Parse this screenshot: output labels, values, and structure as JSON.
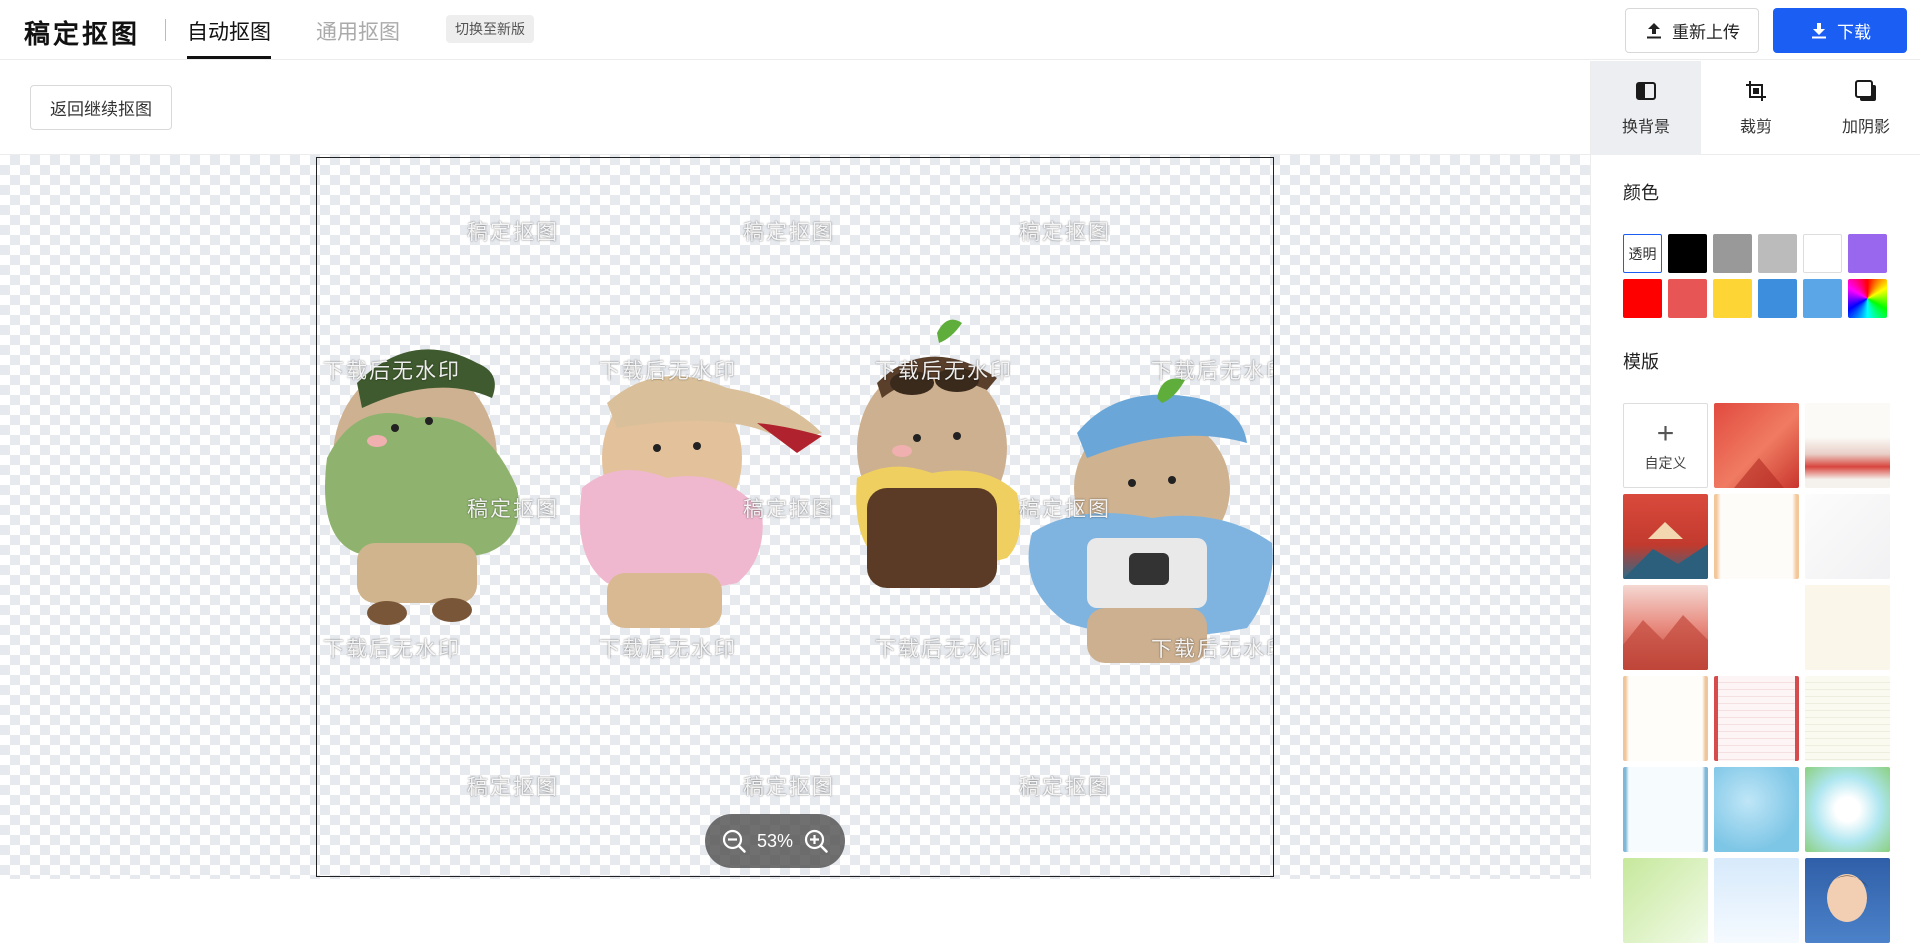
{
  "header": {
    "logo": "稿定抠图",
    "tabs": [
      {
        "label": "自动抠图",
        "active": true
      },
      {
        "label": "通用抠图",
        "active": false
      }
    ],
    "switch_label": "切换至新版",
    "reupload_label": "重新上传",
    "download_label": "下载"
  },
  "toolbar": {
    "back_label": "返回继续抠图"
  },
  "canvas": {
    "zoom": "53%",
    "watermark_logo": "稿定抠图",
    "watermark_note": "下载后无水印"
  },
  "panel": {
    "tabs": [
      {
        "label": "换背景",
        "icon": "background-icon",
        "active": true
      },
      {
        "label": "裁剪",
        "icon": "crop-icon",
        "active": false
      },
      {
        "label": "加阴影",
        "icon": "shadow-icon",
        "active": false
      }
    ],
    "color_title": "颜色",
    "transparent_label": "透明",
    "colors": [
      "#000000",
      "#999999",
      "#bbbbbb",
      "#ffffff",
      "#9966ee",
      "#ff0000",
      "#e85555",
      "#fdd535",
      "#3d8fde",
      "#5aa6e6"
    ],
    "template_title": "模版",
    "custom_label": "自定义"
  },
  "colors": {
    "accent": "#1b5ef4"
  }
}
